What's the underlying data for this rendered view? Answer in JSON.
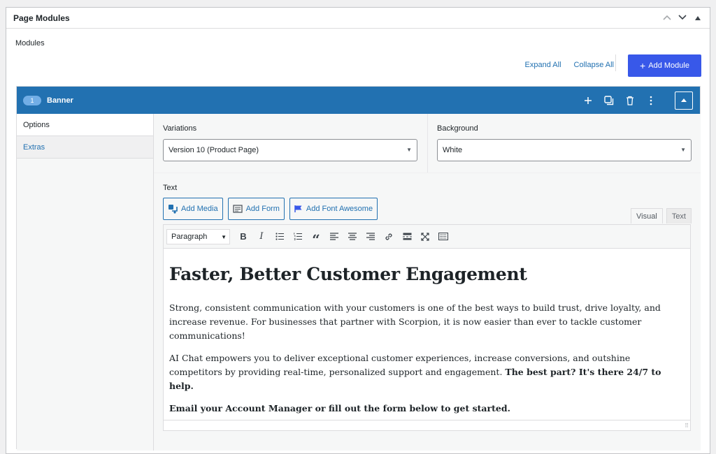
{
  "panel": {
    "title": "Page Modules"
  },
  "modules_label": "Modules",
  "actions": {
    "expand_all": "Expand All",
    "collapse_all": "Collapse All",
    "add_module": "Add Module",
    "add_icon": "+"
  },
  "module": {
    "index": "1",
    "name": "Banner",
    "tabs": [
      {
        "label": "Options"
      },
      {
        "label": "Extras"
      }
    ],
    "variations": {
      "label": "Variations",
      "value": "Version 10 (Product Page)"
    },
    "background": {
      "label": "Background",
      "value": "White"
    },
    "text": {
      "label": "Text",
      "buttons": {
        "add_media": "Add Media",
        "add_form": "Add Form",
        "add_font_awesome": "Add Font Awesome"
      },
      "modes": {
        "visual": "Visual",
        "text": "Text"
      },
      "format": "Paragraph",
      "heading": "Faster, Better Customer Engagement",
      "p1": "Strong, consistent communication with your customers is one of the best ways to build trust, drive loyalty, and increase revenue. For businesses that partner with Scorpion, it is now easier than ever to tackle customer communications!",
      "p2_normal": "AI Chat empowers you to deliver exceptional customer experiences, increase conversions, and outshine competitors by providing real-time, personalized support and engagement.",
      "p2_bold": "The best part? It's there 24/7 to help.",
      "p3_bold": "Email your Account Manager or fill out the form below to get started."
    }
  },
  "colors": {
    "accent": "#2271b1",
    "button": "#3858e9"
  }
}
